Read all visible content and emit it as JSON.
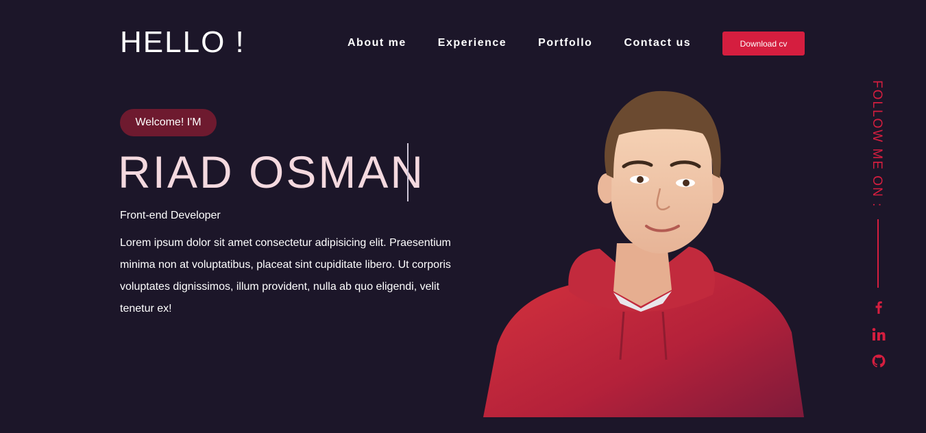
{
  "header": {
    "logo": "HELLO !",
    "nav": [
      "About me",
      "Experience",
      "Portfollo",
      "Contact us"
    ],
    "download_label": "Download cv"
  },
  "hero": {
    "welcome": "Welcome! I'M",
    "name": "RIAD OSMAN",
    "role": "Front-end Developer",
    "bio": "Lorem ipsum dolor sit amet consectetur adipisicing elit. Praesentium minima non at voluptatibus, placeat sint cupiditate libero. Ut corporis voluptates dignissimos, illum provident, nulla ab quo eligendi, velit tenetur ex!"
  },
  "follow": {
    "label": "FOLLOW ME ON :",
    "icons": [
      "facebook-icon",
      "linkedin-icon",
      "github-icon"
    ]
  },
  "colors": {
    "background": "#1c1629",
    "accent": "#d51e3f",
    "pill": "#6e1a2f",
    "name": "#f4d9df"
  }
}
